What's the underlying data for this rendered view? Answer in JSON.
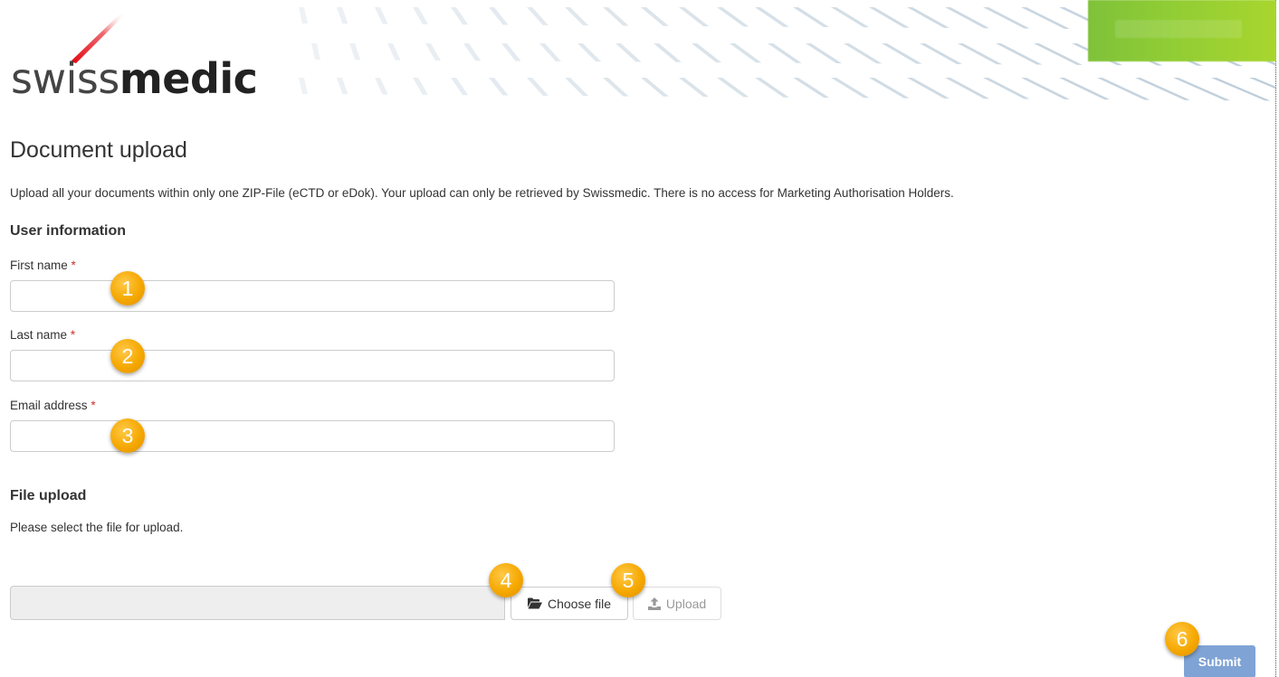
{
  "header": {
    "logo_light": "swiss",
    "logo_bold": "medic",
    "accent_color": "#e30613",
    "green_color": "#8fcc35"
  },
  "page": {
    "title": "Document upload",
    "intro": "Upload all your documents within only one ZIP-File (eCTD or eDok). Your upload can only be retrieved by Swissmedic. There is no access for Marketing Authorisation Holders."
  },
  "user_info": {
    "section_title": "User information",
    "first_name": {
      "label": "First name",
      "required_mark": "*",
      "value": ""
    },
    "last_name": {
      "label": "Last name",
      "required_mark": "*",
      "value": ""
    },
    "email": {
      "label": "Email address",
      "required_mark": "*",
      "value": ""
    }
  },
  "file_upload": {
    "section_title": "File upload",
    "help": "Please select the file for upload.",
    "file_value": "",
    "choose_label": "Choose file",
    "choose_icon": "folder-open-icon",
    "upload_label": "Upload",
    "upload_icon": "upload-icon"
  },
  "submit_label": "Submit",
  "submit_color": "#7fa3d4",
  "markers": [
    "1",
    "2",
    "3",
    "4",
    "5",
    "6"
  ],
  "marker_color": "#f5a800"
}
